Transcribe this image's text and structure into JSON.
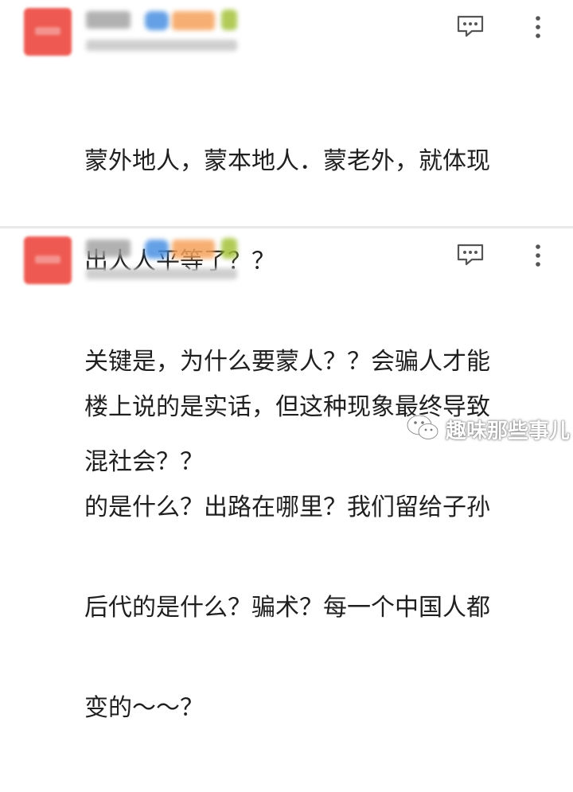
{
  "comments": [
    {
      "lines": [
        "蒙外地人，蒙本地人．蒙老外，就体现",
        "出人人平等了？？",
        "关键是，为什么要蒙人？？会骗人才能",
        "混社会？？"
      ],
      "avatar_color": "#ee5a52"
    },
    {
      "lines": [
        "楼上说的是实话，但这种现象最终导致",
        "的是什么？出路在哪里？我们留给子孙",
        "后代的是什么？骗术？每一个中国人都",
        "变的～～？"
      ],
      "avatar_color": "#ee5a52"
    }
  ],
  "icons": {
    "reply": "comment-reply-icon",
    "more": "more-vertical-icon"
  },
  "watermark": {
    "text": "趣味那些事儿"
  }
}
